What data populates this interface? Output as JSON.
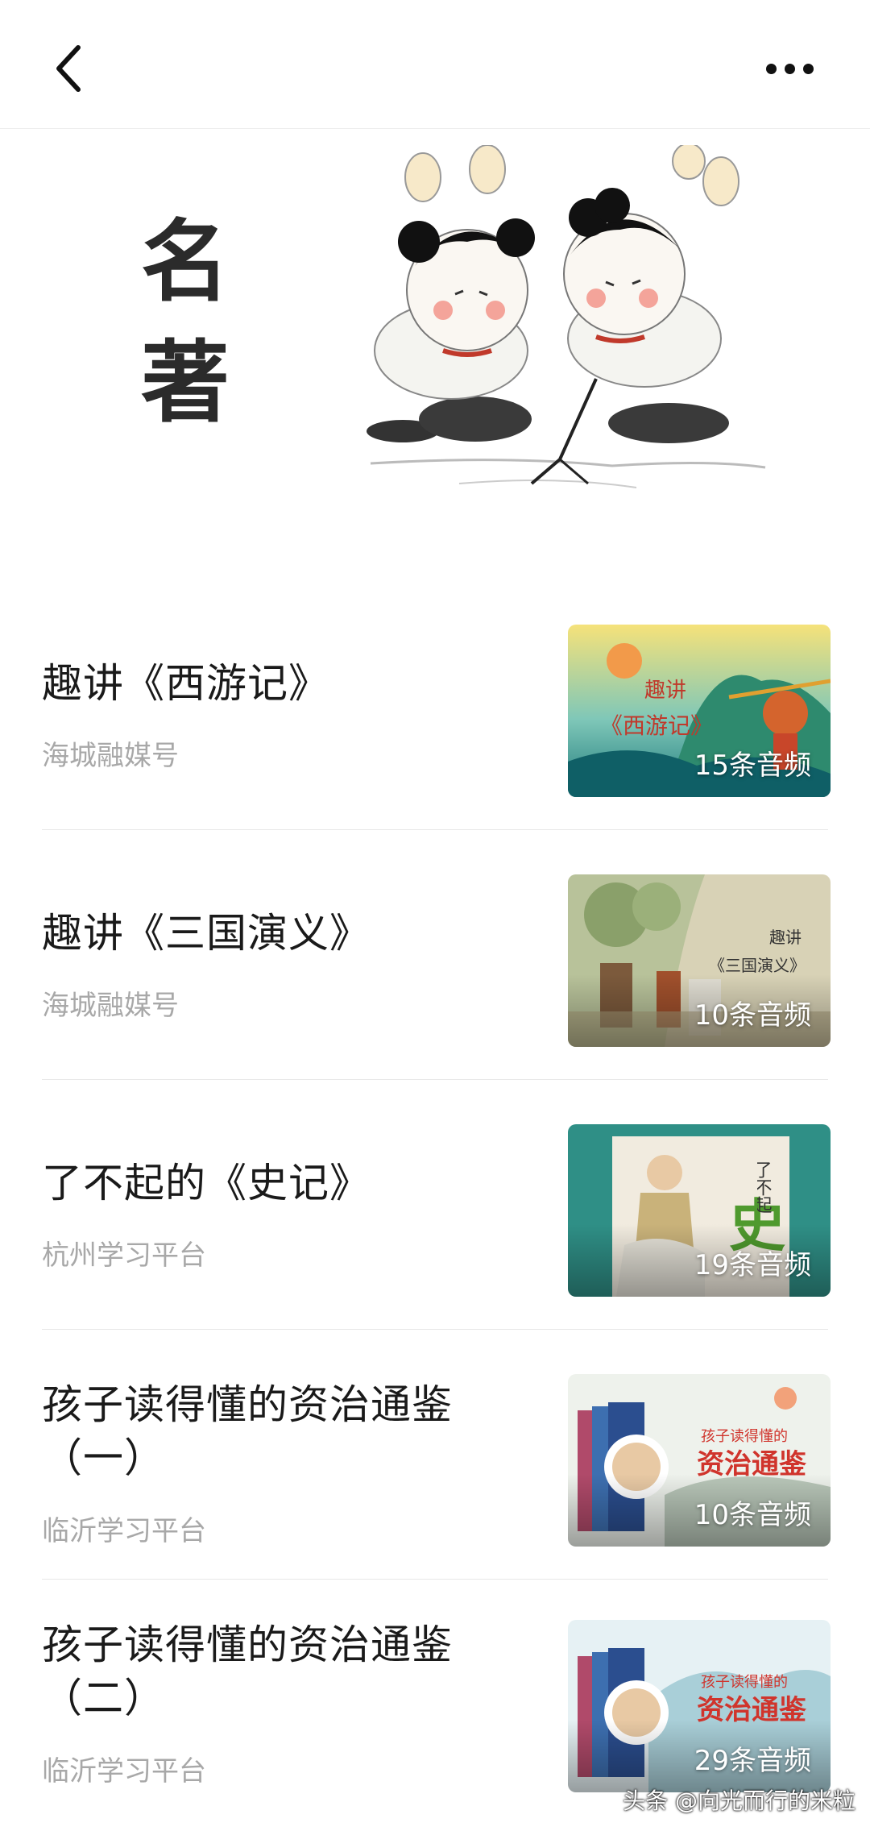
{
  "banner": {
    "title_line1": "名",
    "title_line2": "著"
  },
  "items": [
    {
      "title": "趣讲《西游记》",
      "source": "海城融媒号",
      "count": "15条音频",
      "thumb_text_a": "趣讲",
      "thumb_text_b": "《西游记》"
    },
    {
      "title": "趣讲《三国演义》",
      "source": "海城融媒号",
      "count": "10条音频",
      "thumb_text_a": "趣讲",
      "thumb_text_b": "《三国演义》"
    },
    {
      "title": "了不起的《史记》",
      "source": "杭州学习平台",
      "count": "19条音频",
      "thumb_text_a": "了不起",
      "thumb_text_b": "史"
    },
    {
      "title": "孩子读得懂的资治通鉴（一）",
      "source": "临沂学习平台",
      "count": "10条音频",
      "thumb_text_a": "孩子读得懂的",
      "thumb_text_b": "资治通鉴"
    },
    {
      "title": "孩子读得懂的资治通鉴（二）",
      "source": "临沂学习平台",
      "count": "29条音频",
      "thumb_text_a": "孩子读得懂的",
      "thumb_text_b": "资治通鉴"
    }
  ],
  "watermark": "头条 @向光而行的米粒"
}
